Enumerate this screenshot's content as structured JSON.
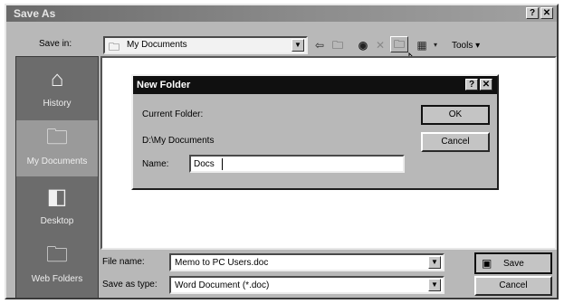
{
  "window": {
    "title": "Save As",
    "help_glyph": "?",
    "close_glyph": "✕"
  },
  "toolbar": {
    "save_in_label": "Save in:",
    "save_in_value": "My Documents",
    "tools_label": "Tools ▾",
    "icons": [
      "back-icon",
      "up-folder-icon",
      "search-web-icon",
      "delete-icon",
      "new-folder-icon",
      "views-icon"
    ]
  },
  "places": [
    {
      "label": "History",
      "icon": "history-icon"
    },
    {
      "label": "My Documents",
      "icon": "my-documents-icon"
    },
    {
      "label": "Desktop",
      "icon": "desktop-icon"
    },
    {
      "label": "Web Folders",
      "icon": "web-folders-icon"
    }
  ],
  "bottom": {
    "file_name_label": "File name:",
    "file_name_value": "Memo to PC Users.doc",
    "save_as_type_label": "Save as type:",
    "save_as_type_value": "Word Document (*.doc)",
    "save_label": "Save",
    "cancel_label": "Cancel"
  },
  "new_folder": {
    "title": "New Folder",
    "help_glyph": "?",
    "close_glyph": "✕",
    "current_folder_label": "Current Folder:",
    "current_folder_path": "D:\\My Documents",
    "name_label": "Name:",
    "name_value": "Docs",
    "ok_label": "OK",
    "cancel_label": "Cancel"
  }
}
